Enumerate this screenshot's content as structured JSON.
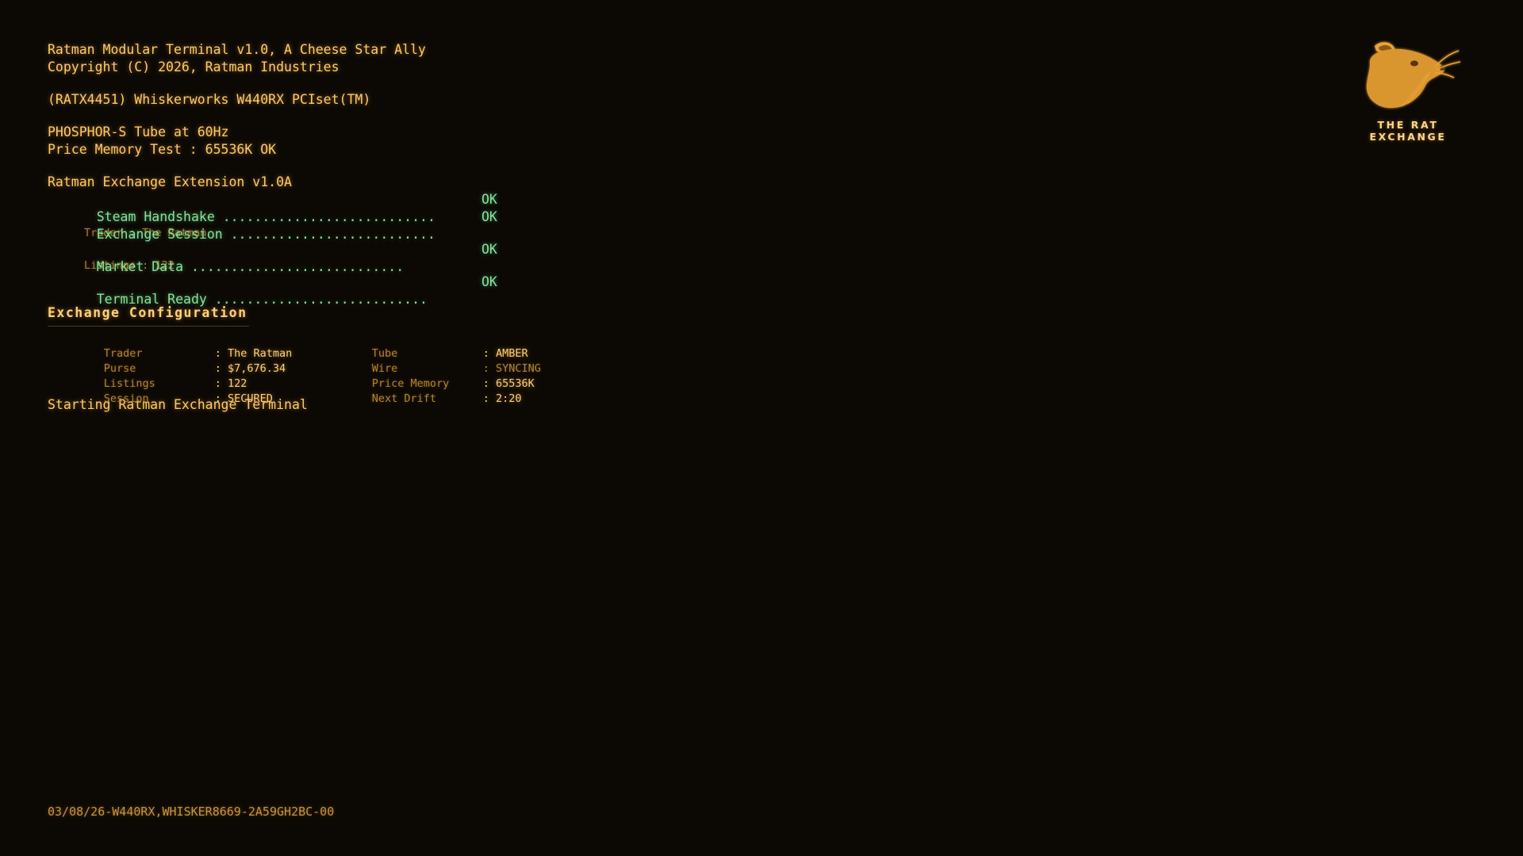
{
  "header": {
    "title_line": "Ratman Modular Terminal v1.0, A Cheese Star Ally",
    "copyright_line": "Copyright (C) 2026, Ratman Industries",
    "chipset_line": "(RATX4451) Whiskerworks W440RX PCIset(TM)",
    "tube_line": "PHOSPHOR-S Tube at 60Hz",
    "memory_line": "Price Memory Test : 65536K OK"
  },
  "extension": {
    "title": "Ratman Exchange Extension v1.0A",
    "checks": [
      {
        "label": "Steam Handshake ...........................",
        "status": "OK"
      },
      {
        "label": "Exchange Session ..........................",
        "status": "OK",
        "detail": "Trader : The Ratman"
      },
      {
        "label": "Market Data ...........................",
        "status": "OK",
        "detail": "Listings : 122"
      },
      {
        "label": "Terminal Ready ...........................",
        "status": "OK"
      }
    ]
  },
  "config": {
    "title": "Exchange Configuration",
    "left": [
      {
        "key": "Trader",
        "value": ": The Ratman"
      },
      {
        "key": "Purse",
        "value": ": $7,676.34"
      },
      {
        "key": "Listings",
        "value": ": 122"
      },
      {
        "key": "Session",
        "value": ": SECURED"
      }
    ],
    "right": [
      {
        "key": "Tube",
        "value": ": AMBER"
      },
      {
        "key": "Wire",
        "value": ": SYNCING"
      },
      {
        "key": "Price Memory",
        "value": ": 65536K"
      },
      {
        "key": "Next Drift",
        "value": ": 2:20"
      }
    ]
  },
  "status_line": "Starting Ratman Exchange Terminal",
  "footer": "03/08/26-W440RX,WHISKER8669-2A59GH2BC-00",
  "logo": {
    "icon": "rat-head-icon",
    "text": "THE RAT EXCHANGE"
  },
  "colors": {
    "background": "#0c0905",
    "amber": "#ffc860",
    "green": "#86e39a",
    "dim": "#b2842f"
  }
}
